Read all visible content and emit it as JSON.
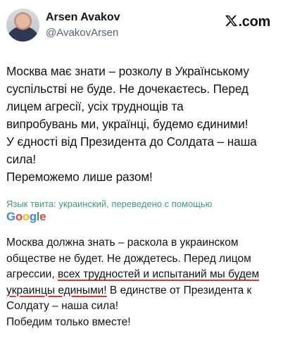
{
  "author": {
    "name": "Arsen Avakov",
    "handle": "@AvakovArsen"
  },
  "brand": {
    "icon": "x-logo-icon",
    "text": ".com"
  },
  "tweet": {
    "original_lines": [
      "Москва має знати – розколу в Українському",
      "суспільстві не буде.  Не дочекаєтесь.  Перед",
      "лицем агресії, усіх труднощів та",
      "випробувань ми, українці, будемо єдиними!",
      "У єдності від Президента до Солдата – наша",
      "сила!",
      "Переможемо лише разом!"
    ],
    "translation_label": "Язык твита: украинский, переведено с помощью",
    "translation_provider": "Google",
    "translated": {
      "line1": "Москва должна знать – раскола в украинском",
      "line2": "обществе не будет. Не дождетесь. Перед лицом",
      "line3_start": "агрессии, ",
      "line3_highlight": "всех трудностей и испытаний мы будем",
      "line4_highlight": "украинцы едиными!",
      "line4_end": " В единстве от Президента к",
      "line5": "Солдату – наша сила!",
      "line6": "Победим только вместе!"
    },
    "highlight_color": "#e0362c"
  }
}
